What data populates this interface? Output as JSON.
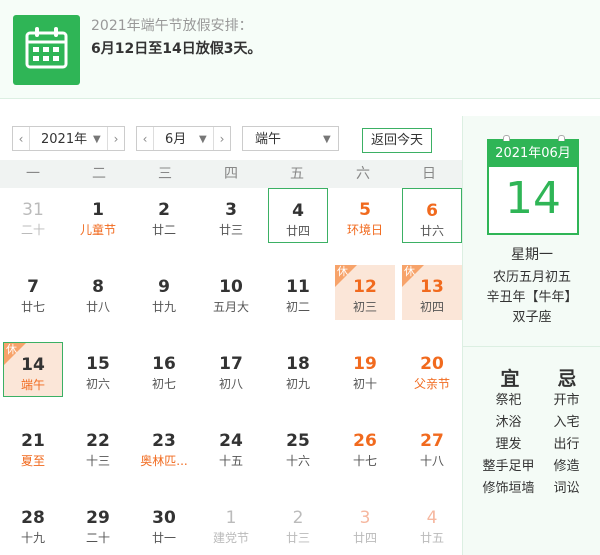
{
  "notice": {
    "title": "2021年端午节放假安排：",
    "body": "6月12日至14日放假3天。"
  },
  "toolbar": {
    "year": "2021年",
    "month": "6月",
    "holiday": "端午",
    "today_button": "返回今天",
    "prev_arrow": "‹",
    "next_arrow": "›",
    "caret": "▼"
  },
  "weekdays": [
    "一",
    "二",
    "三",
    "四",
    "五",
    "六",
    "日"
  ],
  "days": [
    {
      "num": "31",
      "sub": "二十",
      "state": "other"
    },
    {
      "num": "1",
      "sub": "儿童节",
      "state": "redsub"
    },
    {
      "num": "2",
      "sub": "廿二",
      "state": ""
    },
    {
      "num": "3",
      "sub": "廿三",
      "state": ""
    },
    {
      "num": "4",
      "sub": "廿四",
      "state": "outlined"
    },
    {
      "num": "5",
      "sub": "环境日",
      "state": "red redsub"
    },
    {
      "num": "6",
      "sub": "廿六",
      "state": "red outlined"
    },
    {
      "num": "7",
      "sub": "廿七",
      "state": ""
    },
    {
      "num": "8",
      "sub": "廿八",
      "state": ""
    },
    {
      "num": "9",
      "sub": "廿九",
      "state": ""
    },
    {
      "num": "10",
      "sub": "五月大",
      "state": ""
    },
    {
      "num": "11",
      "sub": "初二",
      "state": ""
    },
    {
      "num": "12",
      "sub": "初三",
      "state": "red holiday",
      "tag": "休"
    },
    {
      "num": "13",
      "sub": "初四",
      "state": "red holiday",
      "tag": "休"
    },
    {
      "num": "14",
      "sub": "端午",
      "state": "today holiday redsub",
      "tag": "休"
    },
    {
      "num": "15",
      "sub": "初六",
      "state": ""
    },
    {
      "num": "16",
      "sub": "初七",
      "state": ""
    },
    {
      "num": "17",
      "sub": "初八",
      "state": ""
    },
    {
      "num": "18",
      "sub": "初九",
      "state": ""
    },
    {
      "num": "19",
      "sub": "初十",
      "state": "red"
    },
    {
      "num": "20",
      "sub": "父亲节",
      "state": "red redsub"
    },
    {
      "num": "21",
      "sub": "夏至",
      "state": "redsub"
    },
    {
      "num": "22",
      "sub": "十三",
      "state": ""
    },
    {
      "num": "23",
      "sub": "奥林匹...",
      "state": "redsub"
    },
    {
      "num": "24",
      "sub": "十五",
      "state": ""
    },
    {
      "num": "25",
      "sub": "十六",
      "state": ""
    },
    {
      "num": "26",
      "sub": "十七",
      "state": "red"
    },
    {
      "num": "27",
      "sub": "十八",
      "state": "red"
    },
    {
      "num": "28",
      "sub": "十九",
      "state": ""
    },
    {
      "num": "29",
      "sub": "二十",
      "state": ""
    },
    {
      "num": "30",
      "sub": "廿一",
      "state": ""
    },
    {
      "num": "1",
      "sub": "建党节",
      "state": "other"
    },
    {
      "num": "2",
      "sub": "廿三",
      "state": "other"
    },
    {
      "num": "3",
      "sub": "廿四",
      "state": "other redfade"
    },
    {
      "num": "4",
      "sub": "廿五",
      "state": "other redfade"
    }
  ],
  "side": {
    "month_label": "2021年06月",
    "day": "14",
    "weekday": "星期一",
    "lunar": "农历五月初五",
    "ganzhi": "辛丑年【牛年】",
    "zodiac": "双子座",
    "yi_title": "宜",
    "ji_title": "忌",
    "yi": [
      "祭祀",
      "沐浴",
      "理发",
      "整手足甲",
      "修饰垣墙"
    ],
    "ji": [
      "开市",
      "入宅",
      "出行",
      "修造",
      "词讼"
    ]
  },
  "colors": {
    "accent_green": "#2fb556",
    "weekend_red": "#f16a1e",
    "holiday_bg": "#fbe6d8"
  }
}
